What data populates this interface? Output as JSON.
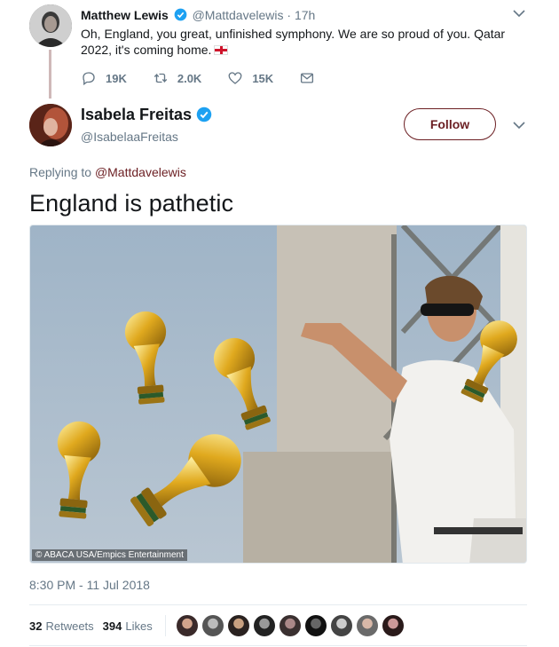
{
  "parent_tweet": {
    "name": "Matthew Lewis",
    "handle": "@Mattdavelewis",
    "dot": "·",
    "time": "17h",
    "text": "Oh, England, you great, unfinished symphony. We are so proud of you. Qatar 2022, it's coming home.",
    "flag_icon": "england-flag",
    "replies": "19K",
    "retweets": "2.0K",
    "likes": "15K"
  },
  "main_tweet": {
    "name": "Isabela Freitas",
    "handle": "@IsabelaaFreitas",
    "follow_label": "Follow",
    "replying_prefix": "Replying to",
    "replying_handle": "@Mattdavelewis",
    "text": "England is pathetic",
    "image_credit": "© ABACA USA/Empics Entertainment",
    "timestamp": "8:30 PM - 11 Jul 2018",
    "retweets_count": "32",
    "retweets_label": "Retweets",
    "likes_count": "394",
    "likes_label": "Likes"
  },
  "colors": {
    "accent": "#6b1e22",
    "verified": "#1da1f2",
    "secondary_text": "#657786"
  },
  "icons": [
    "verified-badge-icon",
    "chevron-down-icon",
    "reply-icon",
    "retweet-icon",
    "like-icon",
    "message-icon"
  ]
}
